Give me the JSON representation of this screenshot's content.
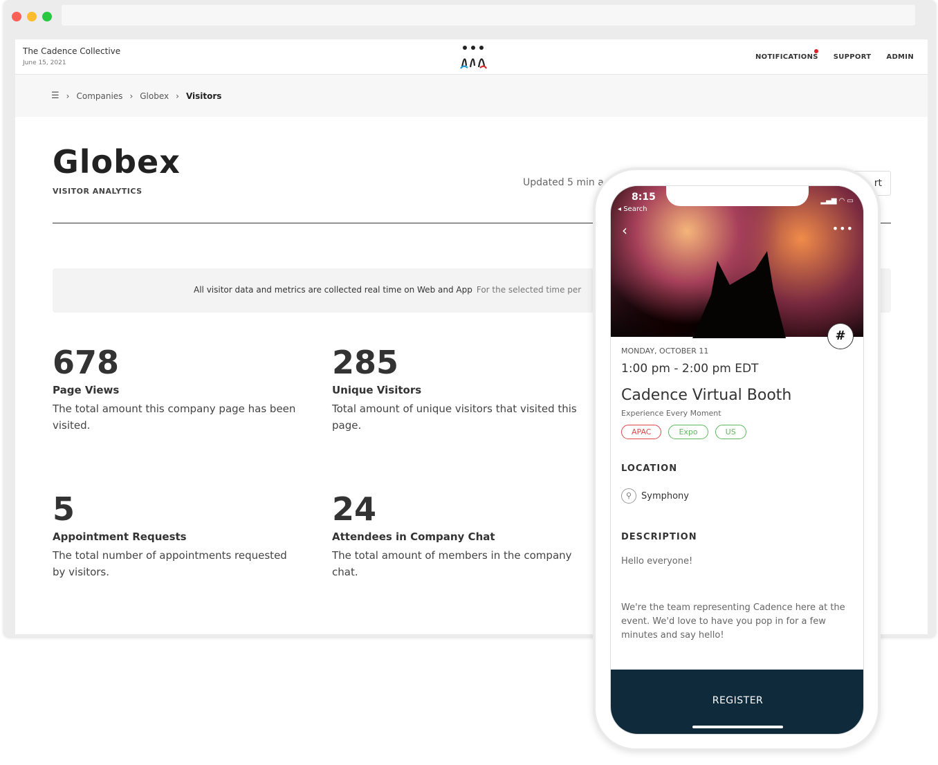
{
  "header": {
    "org": "The Cadence Collective",
    "date": "June 15, 2021",
    "nav": [
      "NOTIFICATIONS",
      "SUPPORT",
      "ADMIN"
    ]
  },
  "breadcrumb": [
    "Companies",
    "Globex",
    "Visitors"
  ],
  "title": "Globex",
  "subtitle": "VISITOR ANALYTICS",
  "updated": "Updated 5 min a",
  "export": "rt",
  "note": {
    "bold": "All visitor data and metrics are collected real time on Web and App",
    "light": "For the selected time per"
  },
  "stats": [
    {
      "value": "678",
      "label": "Page Views",
      "desc": "The total amount this company page has been visited."
    },
    {
      "value": "285",
      "label": "Unique Visitors",
      "desc": "Total amount of unique visitors that visited this page."
    },
    {
      "value": "5",
      "label": "Appointment Requests",
      "desc": "The total number of appointments requested by visitors."
    },
    {
      "value": "24",
      "label": "Attendees in Company Chat",
      "desc": "The total amount of members in the company chat."
    }
  ],
  "phone": {
    "time": "8:15",
    "back": "◂ Search",
    "day": "MONDAY, OCTOBER 11",
    "hours": "1:00 pm - 2:00 pm EDT",
    "event": "Cadence Virtual Booth",
    "tagline": "Experience Every Moment",
    "tags": [
      {
        "label": "APAC",
        "color": "#e04848"
      },
      {
        "label": "Expo",
        "color": "#5cb85c"
      },
      {
        "label": "US",
        "color": "#5cb85c"
      }
    ],
    "location_h": "LOCATION",
    "location": "Symphony",
    "desc_h": "DESCRIPTION",
    "desc1": "Hello everyone!",
    "desc2": "We're the team representing Cadence here at the event. We'd love to have you pop in for a few minutes and say hello!",
    "register": "REGISTER"
  }
}
